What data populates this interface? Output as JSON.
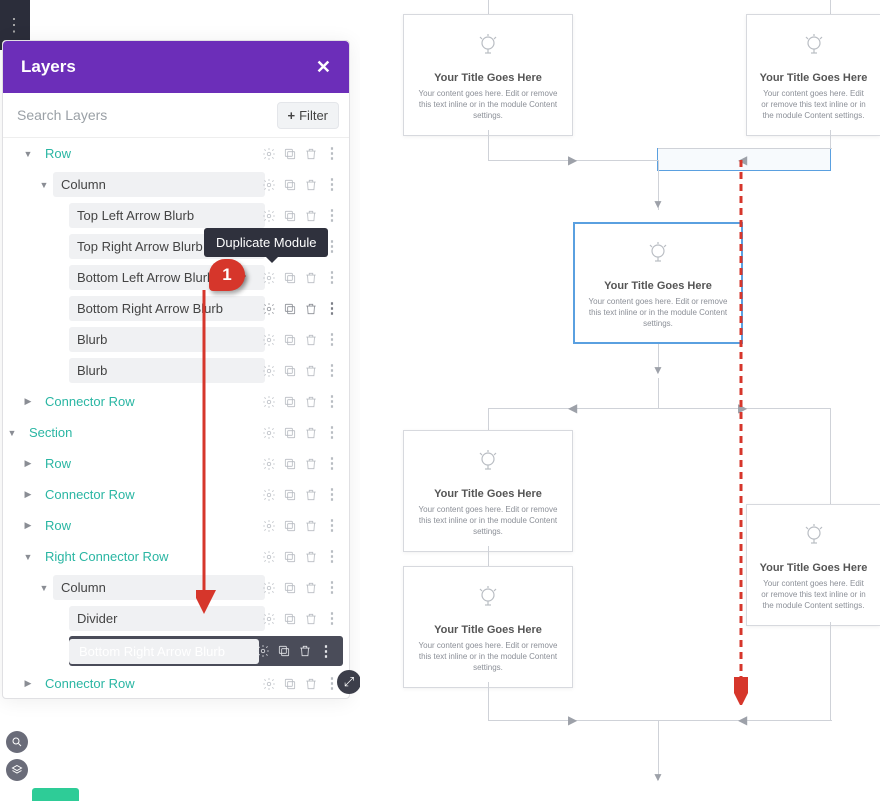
{
  "panel": {
    "title": "Layers",
    "search_placeholder": "Search Layers",
    "filter_label": "Filter",
    "tooltip": "Duplicate Module",
    "step_number": "1"
  },
  "tree": [
    {
      "depth": 1,
      "label": "Row",
      "teal": true,
      "caret": "down"
    },
    {
      "depth": 2,
      "label": "Column",
      "caret": "down"
    },
    {
      "depth": 3,
      "label": "Top Left Arrow Blurb"
    },
    {
      "depth": 3,
      "label": "Top Right Arrow Blurb"
    },
    {
      "depth": 3,
      "label": "Bottom Left Arrow Blurb"
    },
    {
      "depth": 3,
      "label": "Bottom Right Arrow Blurb",
      "hl": true
    },
    {
      "depth": 3,
      "label": "Blurb"
    },
    {
      "depth": 3,
      "label": "Blurb"
    },
    {
      "depth": 1,
      "label": "Connector Row",
      "teal": true,
      "caret": "right"
    },
    {
      "depth": 0,
      "label": "Section",
      "teal": true,
      "caret": "down"
    },
    {
      "depth": 1,
      "label": "Row",
      "teal": true,
      "caret": "right"
    },
    {
      "depth": 1,
      "label": "Connector Row",
      "teal": true,
      "caret": "right"
    },
    {
      "depth": 1,
      "label": "Row",
      "teal": true,
      "caret": "right"
    },
    {
      "depth": 1,
      "label": "Right Connector Row",
      "teal": true,
      "caret": "down"
    },
    {
      "depth": 2,
      "label": "Column",
      "caret": "down"
    },
    {
      "depth": 3,
      "label": "Divider"
    },
    {
      "depth": 3,
      "label": "Bottom Right Arrow Blurb",
      "dark": true
    },
    {
      "depth": 1,
      "label": "Connector Row",
      "teal": true,
      "caret": "right"
    }
  ],
  "cards": [
    {
      "title": "Your Title Goes Here",
      "body": "Your content goes here. Edit or remove this text inline or in the module Content settings."
    },
    {
      "title": "Your Title Goes Here",
      "body": "Your content goes here. Edit or remove this text inline or in the module Content settings."
    },
    {
      "title": "Your Title Goes Here",
      "body": "Your content goes here. Edit or remove this text inline or in the module Content settings."
    },
    {
      "title": "Your Title Goes Here",
      "body": "Your content goes here. Edit or remove this text inline or in the module Content settings."
    },
    {
      "title": "Your Title Goes Here",
      "body": "Your content goes here. Edit or remove this text inline or in the module Content settings."
    },
    {
      "title": "Your Title Goes Here",
      "body": "Your content goes here. Edit or remove this text inline or in the module Content settings."
    }
  ],
  "colors": {
    "accent": "#6c2eb9",
    "teal": "#2ab6a3",
    "badge": "#d6362b"
  }
}
